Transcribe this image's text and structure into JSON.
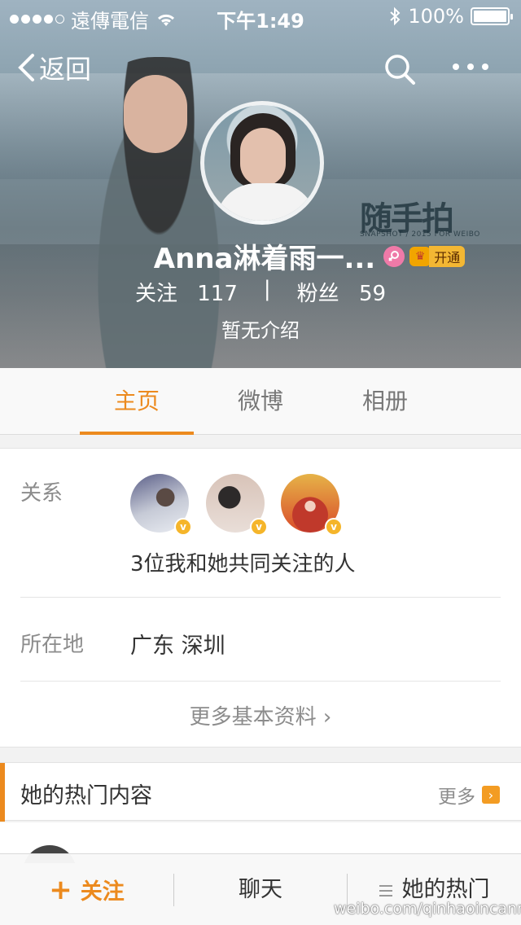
{
  "status_bar": {
    "carrier": "遠傳電信",
    "time": "下午1:49",
    "battery": "100%"
  },
  "nav": {
    "back_label": "返回"
  },
  "header_watermark": {
    "title": "随手拍",
    "subtitle": "SNAPSHOT / 2015 FOR WEIBO"
  },
  "profile": {
    "name": "Anna淋着雨一...",
    "vip_label": "开通",
    "following_label": "关注",
    "following_count": "117",
    "separator": "|",
    "followers_label": "粉丝",
    "followers_count": "59",
    "bio": "暂无介绍"
  },
  "tabs": [
    {
      "label": "主页",
      "active": true
    },
    {
      "label": "微博",
      "active": false
    },
    {
      "label": "相册",
      "active": false
    }
  ],
  "info": {
    "relation_label": "关系",
    "relation_text": "3位我和她共同关注的人",
    "verified_mark": "v",
    "location_label": "所在地",
    "location_value": "广东 深圳",
    "more_info": "更多基本资料 ›"
  },
  "hot": {
    "title": "她的热门内容",
    "more": "更多",
    "more_arrow": "›"
  },
  "bottom_bar": {
    "follow_plus": "+",
    "follow": "关注",
    "chat": "聊天",
    "her_hot": "她的热门"
  },
  "watermark_url": "weibo.com/qinhaoincannes",
  "colors": {
    "accent": "#ec8a1e",
    "label_gray": "#8c8c8c",
    "vip_gold": "#f3b733",
    "female_pink": "#ef7aa8"
  }
}
